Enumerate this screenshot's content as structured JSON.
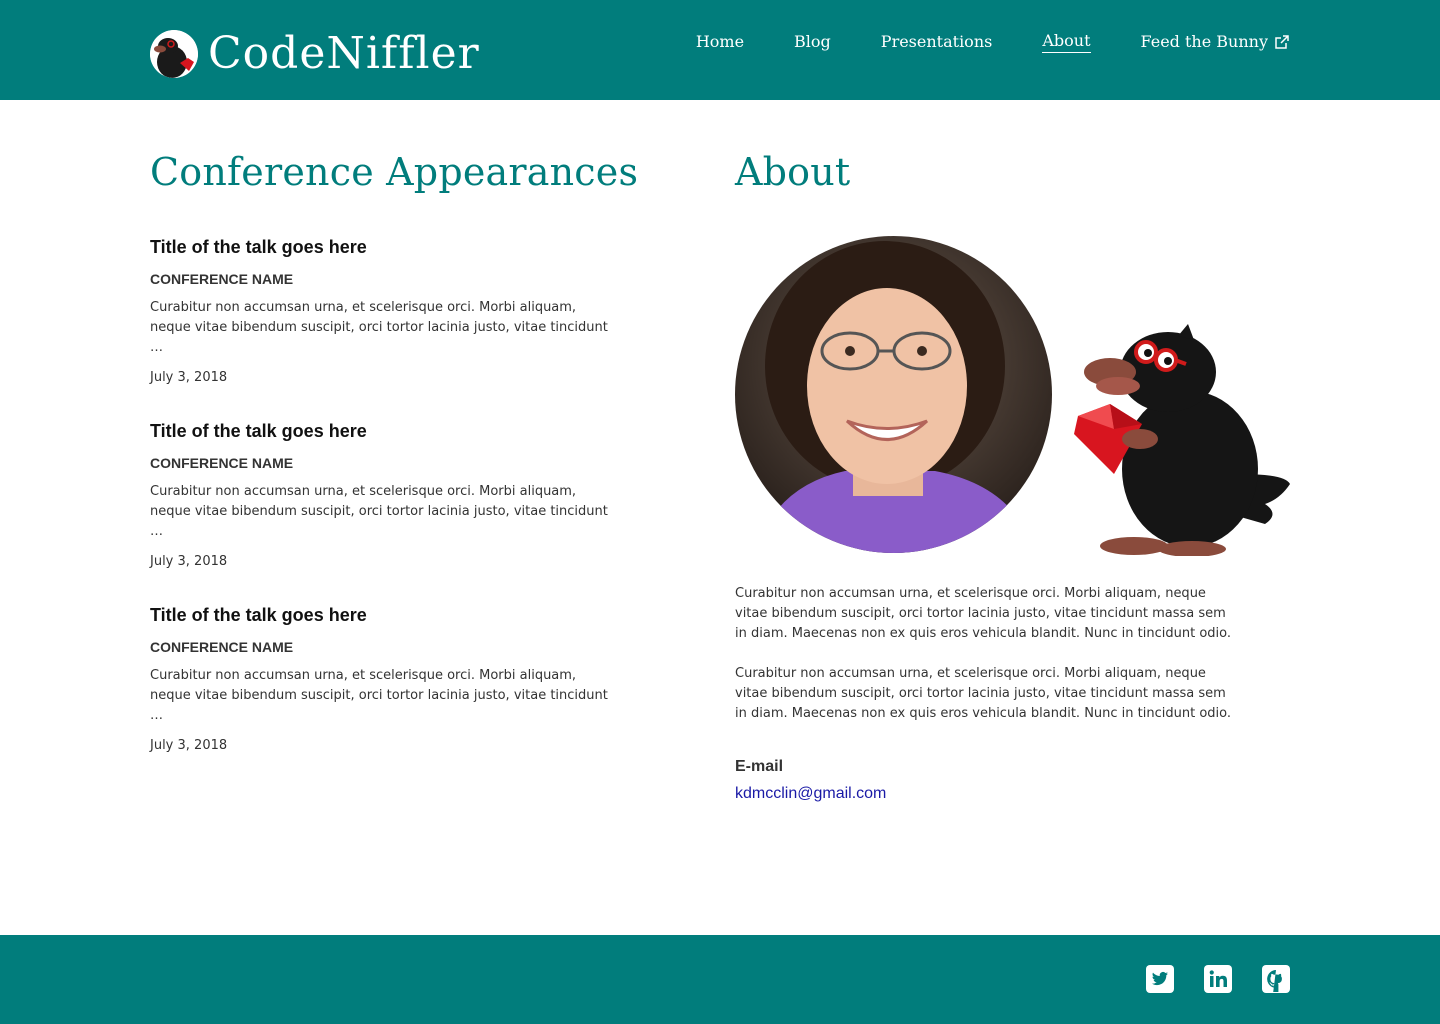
{
  "brand": {
    "name": "CodeNiffler",
    "accent": "#017d7c"
  },
  "nav": {
    "items": [
      {
        "label": "Home"
      },
      {
        "label": "Blog"
      },
      {
        "label": "Presentations"
      },
      {
        "label": "About",
        "active": true
      },
      {
        "label": "Feed the Bunny",
        "icon": "external-link-icon"
      }
    ]
  },
  "conferences": {
    "heading": "Conference Appearances",
    "talks": [
      {
        "title": "Title of the talk goes here",
        "conference": "CONFERENCE NAME",
        "description": "Curabitur non accumsan urna, et scelerisque orci. Morbi aliquam, neque vitae bibendum suscipit, orci tortor lacinia justo, vitae tincidunt …",
        "date": "July 3, 2018"
      },
      {
        "title": "Title of the talk goes here",
        "conference": "CONFERENCE NAME",
        "description": "Curabitur non accumsan urna, et scelerisque orci. Morbi aliquam, neque vitae bibendum suscipit, orci tortor lacinia justo, vitae tincidunt …",
        "date": "July 3, 2018"
      },
      {
        "title": "Title of the talk goes here",
        "conference": "CONFERENCE NAME",
        "description": "Curabitur non accumsan urna, et scelerisque orci. Morbi aliquam, neque vitae bibendum suscipit, orci tortor lacinia justo, vitae tincidunt …",
        "date": "July 3, 2018"
      }
    ]
  },
  "about": {
    "heading": "About",
    "paragraphs": [
      "Curabitur non accumsan urna, et scelerisque orci. Morbi aliquam, neque vitae bibendum suscipit, orci tortor lacinia justo, vitae tincidunt massa sem in diam. Maecenas non ex quis eros vehicula blandit. Nunc in tincidunt odio.",
      "Curabitur non accumsan urna, et scelerisque orci. Morbi aliquam, neque vitae bibendum suscipit, orci tortor lacinia justo, vitae tincidunt massa sem in diam. Maecenas non ex quis eros vehicula blandit. Nunc in tincidunt odio."
    ],
    "email_label": "E-mail",
    "email": "kdmcclin@gmail.com"
  },
  "footer": {
    "social": [
      "twitter-icon",
      "linkedin-icon",
      "github-icon"
    ]
  }
}
